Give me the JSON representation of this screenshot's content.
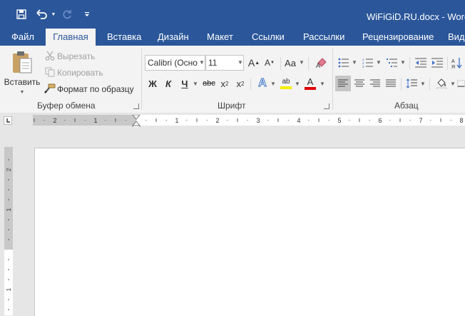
{
  "window": {
    "title": "WiFiGiD.RU.docx - Word ("
  },
  "colors": {
    "brand": "#2b579a",
    "ribbon_bg": "#f3f3f3",
    "workspace": "#e6e6e6"
  },
  "quick_access": {
    "save": "save-icon",
    "undo": "undo-icon",
    "redo": "redo-icon",
    "customize": "customize-icon"
  },
  "tabs": [
    "Файл",
    "Главная",
    "Вставка",
    "Дизайн",
    "Макет",
    "Ссылки",
    "Рассылки",
    "Рецензирование",
    "Вид"
  ],
  "active_tab": "Главная",
  "clipboard": {
    "paste": "Вставить",
    "cut": "Вырезать",
    "copy": "Копировать",
    "format_painter": "Формат по образцу",
    "group_label": "Буфер обмена"
  },
  "font": {
    "name": "Calibri (Осно",
    "size": "11",
    "grow": "A",
    "shrink": "A",
    "case": "Aa",
    "bold": "Ж",
    "italic": "К",
    "underline": "Ч",
    "strike": "abc",
    "subscript": "x",
    "subscript_mark": "2",
    "superscript": "x",
    "superscript_mark": "2",
    "effects": "A",
    "highlight": "ab",
    "color": "A",
    "group_label": "Шрифт"
  },
  "paragraph": {
    "group_label": "Абзац"
  },
  "ruler": {
    "h_labels": [
      "2",
      "1",
      "1",
      "2",
      "3",
      "4",
      "5",
      "6",
      "7",
      "8"
    ],
    "v_labels": [
      "2",
      "1",
      "1"
    ]
  }
}
